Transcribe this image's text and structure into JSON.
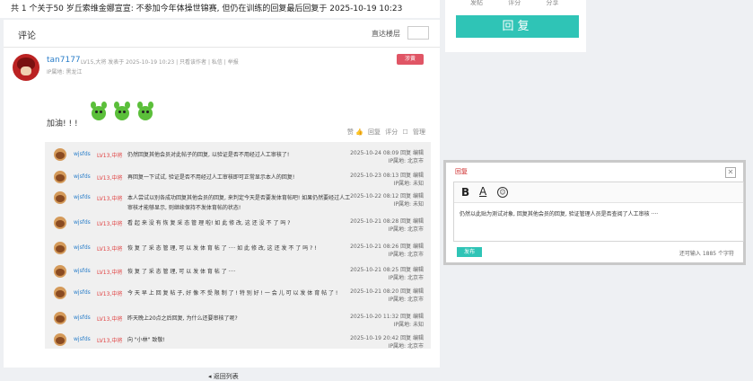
{
  "topbar": {
    "text": "共 1 个关于50 岁丘索维金娜宣宣: 不参加今年体操世锦赛, 但仍在训练的回复最后回复于 2025-10-19 10:23"
  },
  "comments": {
    "title": "评论",
    "jump_label": "直达楼层"
  },
  "post": {
    "author": "tan7177",
    "meta": "LV15,大将  发表于 2025-10-19 10:23  |  只看该作者  |  私信  |  举报",
    "ip": "IP属地: 黑龙江",
    "report_label": "涉黄",
    "text": "加油! ! !",
    "actions": {
      "like": "赞 👍",
      "reply": "回复",
      "score": "评分",
      "checkbox": "☐",
      "manage": "管理"
    }
  },
  "replies": [
    {
      "user": "wjsfds",
      "level": "LV13,中将",
      "text": "仍然回复其他会员对此帖子的回复, 以验证是否不用经过人工审核了!",
      "date": "2025-10-24 08:09  回复  编辑",
      "ip": "IP属地: 北京市"
    },
    {
      "user": "wjsfds",
      "level": "LV13,中将",
      "text": "再回复一下试试, 验证是否不用经过人工审核即可正常显示本人的回复!",
      "date": "2025-10-23 08:13  回复  编辑",
      "ip": "IP属地: 未知"
    },
    {
      "user": "wjsfds",
      "level": "LV13,中将",
      "text": "本人尝试以别各成功回复其他会员的回复, 来判定今天是否要发体育帖吧! 如果仍然要经过人工审核才能够显示, 则继续保持不发体育帖的状态!",
      "date": "2025-10-22 08:12  回复  编辑",
      "ip": "IP属地: 未知"
    },
    {
      "user": "wjsfds",
      "level": "LV13,中将",
      "text": "看 起 来 没 有 恢 复 采 态 管 理 啦! 如 此 修 改, 这 还 没 不 了 吗 ?",
      "date": "2025-10-21 08:28  回复  编辑",
      "ip": "IP属地: 北京市"
    },
    {
      "user": "wjsfds",
      "level": "LV13,中将",
      "text": "恢 复 了 采 态 管 理, 可 以 发 体 育 帖 了 ···· 如 此 修 改, 这 还 发 不 了 吗 ? !",
      "date": "2025-10-21 08:26  回复  编辑",
      "ip": "IP属地: 北京市"
    },
    {
      "user": "wjsfds",
      "level": "LV13,中将",
      "text": "恢 复 了 采 态 管 理, 可 以 发 体 育 帖 了 ····",
      "date": "2025-10-21 08:25  回复  编辑",
      "ip": "IP属地: 北京市"
    },
    {
      "user": "wjsfds",
      "level": "LV13,中将",
      "text": "今 天 早 上 回 复 帖 子, 好 像 不 受 限 制 了 ! 特 别 好 ! 一 会 儿 可 以 发 体 育 帖 了 !",
      "date": "2025-10-21 08:20  回复  编辑",
      "ip": "IP属地: 北京市"
    },
    {
      "user": "wjsfds",
      "level": "LV13,中将",
      "text": "昨天晚上20点之后回复, 为什么还要审核了呢?",
      "date": "2025-10-20 11:32  回复  编辑",
      "ip": "IP属地: 未知"
    },
    {
      "user": "wjsfds",
      "level": "LV13,中将",
      "text": "向 \"小林\" 致敬!",
      "date": "2025-10-19 20:42  回复  编辑",
      "ip": "IP属地: 北京市"
    }
  ],
  "back_link": "◂ 返回列表",
  "side": {
    "labels": "发帖 评分 分享",
    "reply_button": "回复"
  },
  "dialog": {
    "title": "回复",
    "close": "✕",
    "toolbar": {
      "bold": "B",
      "font": "A",
      "emoji": "☺"
    },
    "editor_text": "仍然以此贴为测试对象, 回复其他会员的回复, 验证管理人员是否查阅了人工审核 ····",
    "post_button": "发布",
    "counter": "还可输入 1885 个字符"
  }
}
